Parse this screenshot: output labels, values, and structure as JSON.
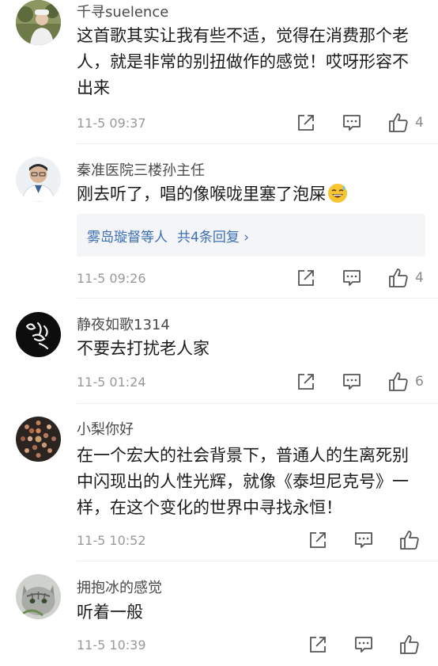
{
  "comments": [
    {
      "user": "千寻suelence",
      "text": "这首歌其实让我有些不适，觉得在消费那个老人，就是非常的别扭做作的感觉！哎呀形容不出来",
      "time": "11-5 09:37",
      "likes": "4",
      "avatar": "photo-avatar"
    },
    {
      "user": "秦准医院三楼孙主任",
      "text": "刚去听了，唱的像喉咙里塞了泡屎",
      "emoji": "sweat-smile-emoji",
      "time": "11-5 09:26",
      "likes": "4",
      "avatar": "doctor-avatar",
      "reply": {
        "names": "雾岛璇督",
        "suffix": "等人",
        "count_text": "共4条回复 ›"
      }
    },
    {
      "user": "静夜如歌1314",
      "text": "不要去打扰老人家",
      "time": "11-5 01:24",
      "likes": "6",
      "avatar": "calligraphy-avatar"
    },
    {
      "user": "小梨你好",
      "text": "在一个宏大的社会背景下，普通人的生离死别中闪现出的人性光辉，就像《泰坦尼克号》一样，在这个变化的世界中寻找永恒！",
      "time": "11-5 10:52",
      "likes": "",
      "avatar": "dots-avatar"
    },
    {
      "user": "拥抱冰的感觉",
      "text": "听着一般",
      "time": "11-5 10:39",
      "likes": "",
      "avatar": "cat-avatar"
    }
  ],
  "colors": {
    "link": "#3d6fb6",
    "meta": "#999999",
    "icon": "#555555"
  },
  "icons": [
    "share-icon",
    "comment-icon",
    "like-icon"
  ]
}
